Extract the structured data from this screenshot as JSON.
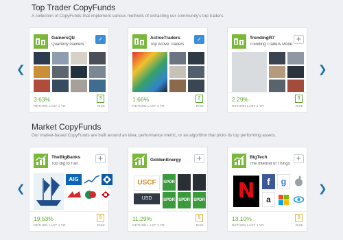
{
  "sections": {
    "top": {
      "title": "Top Trader CopyFunds",
      "description": "A collection of CopyFunds that implement various methods of extracting our community's top traders."
    },
    "market": {
      "title": "Market CopyFunds",
      "description": "Our market-based CopyFunds are built around an idea, performance metric, or an algorithm that picks its top performing assets."
    }
  },
  "labels": {
    "return": "RETURN LAST 1 YR",
    "risk": "RISK"
  },
  "arrows": {
    "left": "❮",
    "right": "❯"
  },
  "cards": [
    {
      "name": "GainersQtr",
      "subtitle": "Quarterly Gainers",
      "return": "3.63%",
      "risk": "3",
      "followed": true,
      "button": "✓",
      "logo_icon": "people-icon"
    },
    {
      "name": "ActiveTraders",
      "subtitle": "Top Active Traders",
      "return": "1.66%",
      "risk": "2",
      "followed": true,
      "button": "✓",
      "logo_icon": "people-icon"
    },
    {
      "name": "TrendingR7",
      "subtitle": "Trending Traders Mode...",
      "return": "2.29%",
      "risk": "3",
      "followed": false,
      "button": "+",
      "logo_icon": "people-icon"
    },
    {
      "name": "TheBigBanks",
      "subtitle": "Too Big to Fail",
      "return": "19.53%",
      "risk": "5",
      "followed": false,
      "button": "+",
      "logo_icon": "chart-icon"
    },
    {
      "name": "GoldenEnergy",
      "subtitle": "",
      "return": "11.29%",
      "risk": "5",
      "followed": false,
      "button": "+",
      "logo_icon": "chart-icon"
    },
    {
      "name": "BigTech",
      "subtitle": "The Internet of Things",
      "return": "13.10%",
      "risk": "5",
      "followed": false,
      "button": "+",
      "logo_icon": "chart-icon"
    }
  ],
  "logos": {
    "aig": "AIG",
    "uscf": "USCF",
    "usd": "USD",
    "spdr": "SPDR",
    "netflix": "N",
    "facebook": "f",
    "google": "g",
    "amazon": "a"
  },
  "colors": {
    "accent": "#3a8fd6",
    "positive": "#5aa82e",
    "brand_green": "#79b83a",
    "risk_amber": "#e6b94a",
    "arrow": "#1f6fa8"
  }
}
